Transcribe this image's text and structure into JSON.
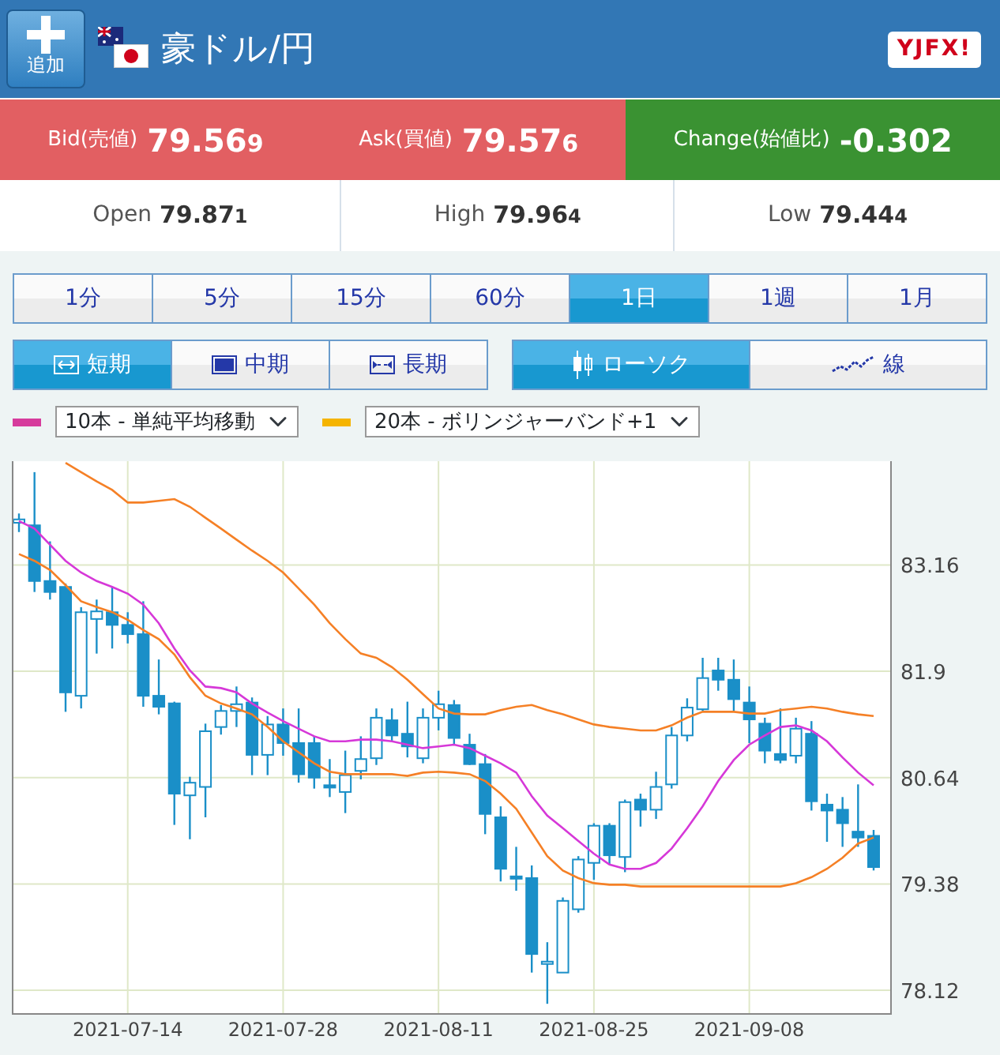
{
  "header": {
    "add_button": "追加",
    "title": "豪ドル/円",
    "logo": "YJFX!"
  },
  "quotes": [
    {
      "kind": "bid",
      "label": "Bid(売値)",
      "main": "79.56",
      "small": "9"
    },
    {
      "kind": "ask",
      "label": "Ask(買値)",
      "main": "79.57",
      "small": "6"
    },
    {
      "kind": "change",
      "label": "Change(始値比)",
      "main": "-0.302"
    }
  ],
  "stats": [
    {
      "label": "Open",
      "main": "79.87",
      "small": "1"
    },
    {
      "label": "High",
      "main": "79.96",
      "small": "4"
    },
    {
      "label": "Low",
      "main": "79.44",
      "small": "4"
    }
  ],
  "timeframes": [
    {
      "label": "1分",
      "selected": false
    },
    {
      "label": "5分",
      "selected": false
    },
    {
      "label": "15分",
      "selected": false
    },
    {
      "label": "60分",
      "selected": false
    },
    {
      "label": "1日",
      "selected": true
    },
    {
      "label": "1週",
      "selected": false
    },
    {
      "label": "1月",
      "selected": false
    }
  ],
  "ranges": [
    {
      "kind": "short",
      "label": "短期",
      "selected": true
    },
    {
      "kind": "medium",
      "label": "中期",
      "selected": false
    },
    {
      "kind": "long",
      "label": "長期",
      "selected": false
    }
  ],
  "chart_types": [
    {
      "kind": "candle",
      "label": "ローソク",
      "selected": true
    },
    {
      "kind": "line",
      "label": "線",
      "selected": false
    }
  ],
  "indicators": [
    {
      "value": "10本 - 単純平均移動",
      "color": "#d63c9c"
    },
    {
      "value": "20本 - ボリンジャーバンド+1",
      "color": "#f5b400"
    }
  ],
  "chart": {
    "chart_data": {
      "type": "candlestick",
      "grid": true,
      "ylim": [
        77.84,
        84.39
      ],
      "categories": [
        null,
        null,
        null,
        null,
        null,
        null,
        null,
        "2021-07-14",
        null,
        null,
        null,
        null,
        null,
        null,
        null,
        null,
        null,
        "2021-07-28",
        null,
        null,
        null,
        null,
        null,
        null,
        null,
        null,
        null,
        "2021-08-11",
        null,
        null,
        null,
        null,
        null,
        null,
        null,
        null,
        null,
        "2021-08-25",
        null,
        null,
        null,
        null,
        null,
        null,
        null,
        null,
        null,
        "2021-09-08",
        null,
        null,
        null,
        null,
        null,
        null,
        null,
        null
      ],
      "yticks": [
        {
          "value": 78.12,
          "label": "78.12"
        },
        {
          "value": 79.38,
          "label": "79.38"
        },
        {
          "value": 80.64,
          "label": "80.64"
        },
        {
          "value": 81.9,
          "label": "81.9"
        },
        {
          "value": 83.16,
          "label": "83.16"
        }
      ],
      "series": [
        {
          "type": "line",
          "color": "#d638d8",
          "values": [
            83.68,
            83.59,
            83.4,
            83.21,
            83.07,
            82.97,
            82.9,
            82.82,
            82.69,
            82.47,
            82.17,
            81.91,
            81.72,
            81.7,
            81.65,
            81.52,
            81.41,
            81.31,
            81.22,
            81.13,
            81.07,
            81.07,
            81.09,
            81.09,
            81.07,
            81.03,
            80.99,
            81.01,
            81.03,
            80.99,
            80.9,
            80.81,
            80.7,
            80.42,
            80.19,
            80.04,
            79.89,
            79.74,
            79.61,
            79.56,
            79.56,
            79.63,
            79.8,
            80.04,
            80.3,
            80.6,
            80.85,
            81.03,
            81.14,
            81.24,
            81.26,
            81.2,
            81.07,
            80.88,
            80.7,
            80.55
          ]
        },
        {
          "type": "line",
          "color": "#f58026",
          "values": [
            null,
            null,
            null,
            84.37,
            84.26,
            84.15,
            84.05,
            83.9,
            83.9,
            83.92,
            83.94,
            83.85,
            83.72,
            83.59,
            83.46,
            83.33,
            83.21,
            83.07,
            82.88,
            82.69,
            82.47,
            82.28,
            82.11,
            82.06,
            81.95,
            81.8,
            81.63,
            81.46,
            81.4,
            81.39,
            81.39,
            81.44,
            81.48,
            81.5,
            81.44,
            81.39,
            81.33,
            81.27,
            81.24,
            81.22,
            81.2,
            81.2,
            81.26,
            81.35,
            81.42,
            81.42,
            81.42,
            81.4,
            81.4,
            81.44,
            81.46,
            81.48,
            81.46,
            81.42,
            81.39,
            81.37
          ]
        },
        {
          "type": "line",
          "color": "#f58026",
          "values": [
            83.29,
            83.21,
            83.1,
            82.92,
            82.73,
            82.66,
            82.6,
            82.51,
            82.39,
            82.28,
            82.1,
            81.83,
            81.61,
            81.52,
            81.46,
            81.39,
            81.24,
            81.07,
            80.94,
            80.81,
            80.71,
            80.68,
            80.68,
            80.68,
            80.68,
            80.66,
            80.7,
            80.71,
            80.7,
            80.68,
            80.6,
            80.45,
            80.27,
            79.99,
            79.71,
            79.54,
            79.45,
            79.39,
            79.37,
            79.37,
            79.35,
            79.35,
            79.35,
            79.35,
            79.35,
            79.35,
            79.35,
            79.35,
            79.35,
            79.35,
            79.39,
            79.46,
            79.56,
            79.69,
            79.86,
            79.93
          ]
        }
      ],
      "ohlc": [
        [
          83.66,
          83.77,
          83.55,
          83.7
        ],
        [
          83.63,
          84.26,
          82.84,
          82.97
        ],
        [
          82.97,
          83.44,
          82.75,
          82.84
        ],
        [
          82.9,
          82.94,
          81.42,
          81.65
        ],
        [
          81.61,
          82.66,
          81.46,
          82.6
        ],
        [
          82.52,
          82.75,
          82.11,
          82.61
        ],
        [
          82.6,
          82.9,
          82.17,
          82.45
        ],
        [
          82.45,
          82.6,
          82.23,
          82.34
        ],
        [
          82.34,
          82.73,
          81.48,
          81.61
        ],
        [
          81.61,
          82.04,
          81.39,
          81.48
        ],
        [
          81.52,
          81.54,
          80.08,
          80.45
        ],
        [
          80.43,
          80.65,
          79.91,
          80.58
        ],
        [
          80.53,
          81.28,
          80.17,
          81.19
        ],
        [
          81.24,
          81.5,
          81.15,
          81.43
        ],
        [
          81.43,
          81.72,
          81.24,
          81.51
        ],
        [
          81.53,
          81.59,
          80.67,
          80.91
        ],
        [
          80.91,
          81.37,
          80.67,
          81.27
        ],
        [
          81.27,
          81.46,
          80.9,
          81.05
        ],
        [
          81.05,
          81.46,
          80.58,
          80.68
        ],
        [
          81.05,
          81.13,
          80.51,
          80.64
        ],
        [
          80.55,
          80.86,
          80.41,
          80.53
        ],
        [
          80.47,
          80.96,
          80.22,
          80.67
        ],
        [
          80.72,
          81.13,
          80.62,
          80.86
        ],
        [
          80.87,
          81.46,
          80.79,
          81.35
        ],
        [
          81.32,
          81.46,
          81.07,
          81.14
        ],
        [
          81.16,
          81.54,
          80.88,
          81.01
        ],
        [
          80.87,
          81.46,
          80.81,
          81.35
        ],
        [
          81.35,
          81.67,
          81.2,
          81.51
        ],
        [
          81.5,
          81.56,
          81.03,
          81.11
        ],
        [
          81.03,
          81.16,
          80.79,
          80.8
        ],
        [
          80.8,
          80.92,
          79.97,
          80.21
        ],
        [
          80.17,
          80.3,
          79.41,
          79.56
        ],
        [
          79.47,
          79.82,
          79.3,
          79.46
        ],
        [
          79.45,
          79.6,
          78.33,
          78.55
        ],
        [
          78.45,
          78.69,
          77.96,
          78.46
        ],
        [
          78.33,
          79.22,
          78.33,
          79.18
        ],
        [
          79.08,
          79.71,
          79.04,
          79.67
        ],
        [
          79.63,
          80.1,
          79.43,
          80.07
        ],
        [
          80.07,
          80.1,
          79.61,
          79.72
        ],
        [
          79.7,
          80.38,
          79.52,
          80.35
        ],
        [
          80.38,
          80.45,
          80.06,
          80.26
        ],
        [
          80.26,
          80.71,
          80.15,
          80.53
        ],
        [
          80.56,
          81.24,
          80.51,
          81.14
        ],
        [
          81.14,
          81.58,
          81.07,
          81.47
        ],
        [
          81.45,
          82.06,
          81.43,
          81.82
        ],
        [
          81.91,
          82.06,
          81.67,
          81.8
        ],
        [
          81.8,
          82.04,
          81.43,
          81.57
        ],
        [
          81.53,
          81.72,
          81.05,
          81.33
        ],
        [
          81.28,
          81.35,
          80.81,
          80.96
        ],
        [
          80.92,
          81.46,
          80.81,
          80.85
        ],
        [
          80.9,
          81.35,
          80.81,
          81.22
        ],
        [
          81.16,
          81.31,
          80.25,
          80.36
        ],
        [
          80.32,
          80.45,
          79.88,
          80.25
        ],
        [
          80.26,
          80.41,
          79.82,
          80.1
        ],
        [
          80.0,
          80.56,
          79.82,
          79.93
        ],
        [
          79.95,
          80.02,
          79.54,
          79.58
        ]
      ]
    }
  }
}
